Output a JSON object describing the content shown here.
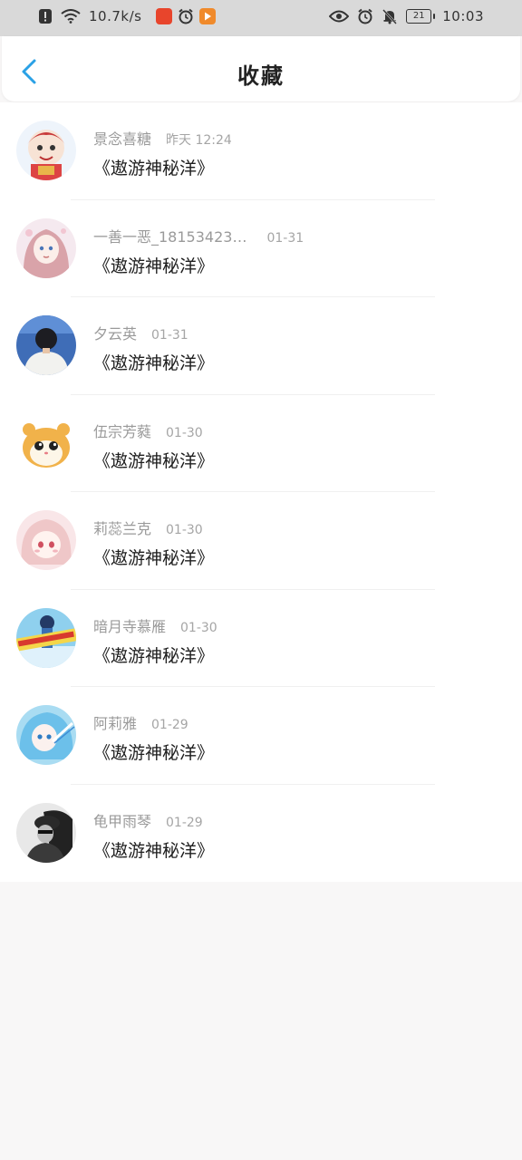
{
  "statusbar": {
    "speed": "10.7k/s",
    "battery": "21",
    "time": "10:03"
  },
  "header": {
    "title": "收藏"
  },
  "items": [
    {
      "name": "景念喜糖",
      "time": "昨天 12:24",
      "message": "《遨游神秘洋》"
    },
    {
      "name": "一善一恶_18153423…",
      "time": "01-31",
      "message": "《遨游神秘洋》"
    },
    {
      "name": "夕云英",
      "time": "01-31",
      "message": "《遨游神秘洋》"
    },
    {
      "name": "伍宗芳蕤",
      "time": "01-30",
      "message": "《遨游神秘洋》"
    },
    {
      "name": "莉蕊兰克",
      "time": "01-30",
      "message": "《遨游神秘洋》"
    },
    {
      "name": "暗月寺慕雁",
      "time": "01-30",
      "message": "《遨游神秘洋》"
    },
    {
      "name": "阿莉雅",
      "time": "01-29",
      "message": "《遨游神秘洋》"
    },
    {
      "name": "龟甲雨琴",
      "time": "01-29",
      "message": "《遨游神秘洋》"
    }
  ],
  "colors": {
    "accent": "#2aa1e6",
    "background": "#f8f7f7"
  }
}
